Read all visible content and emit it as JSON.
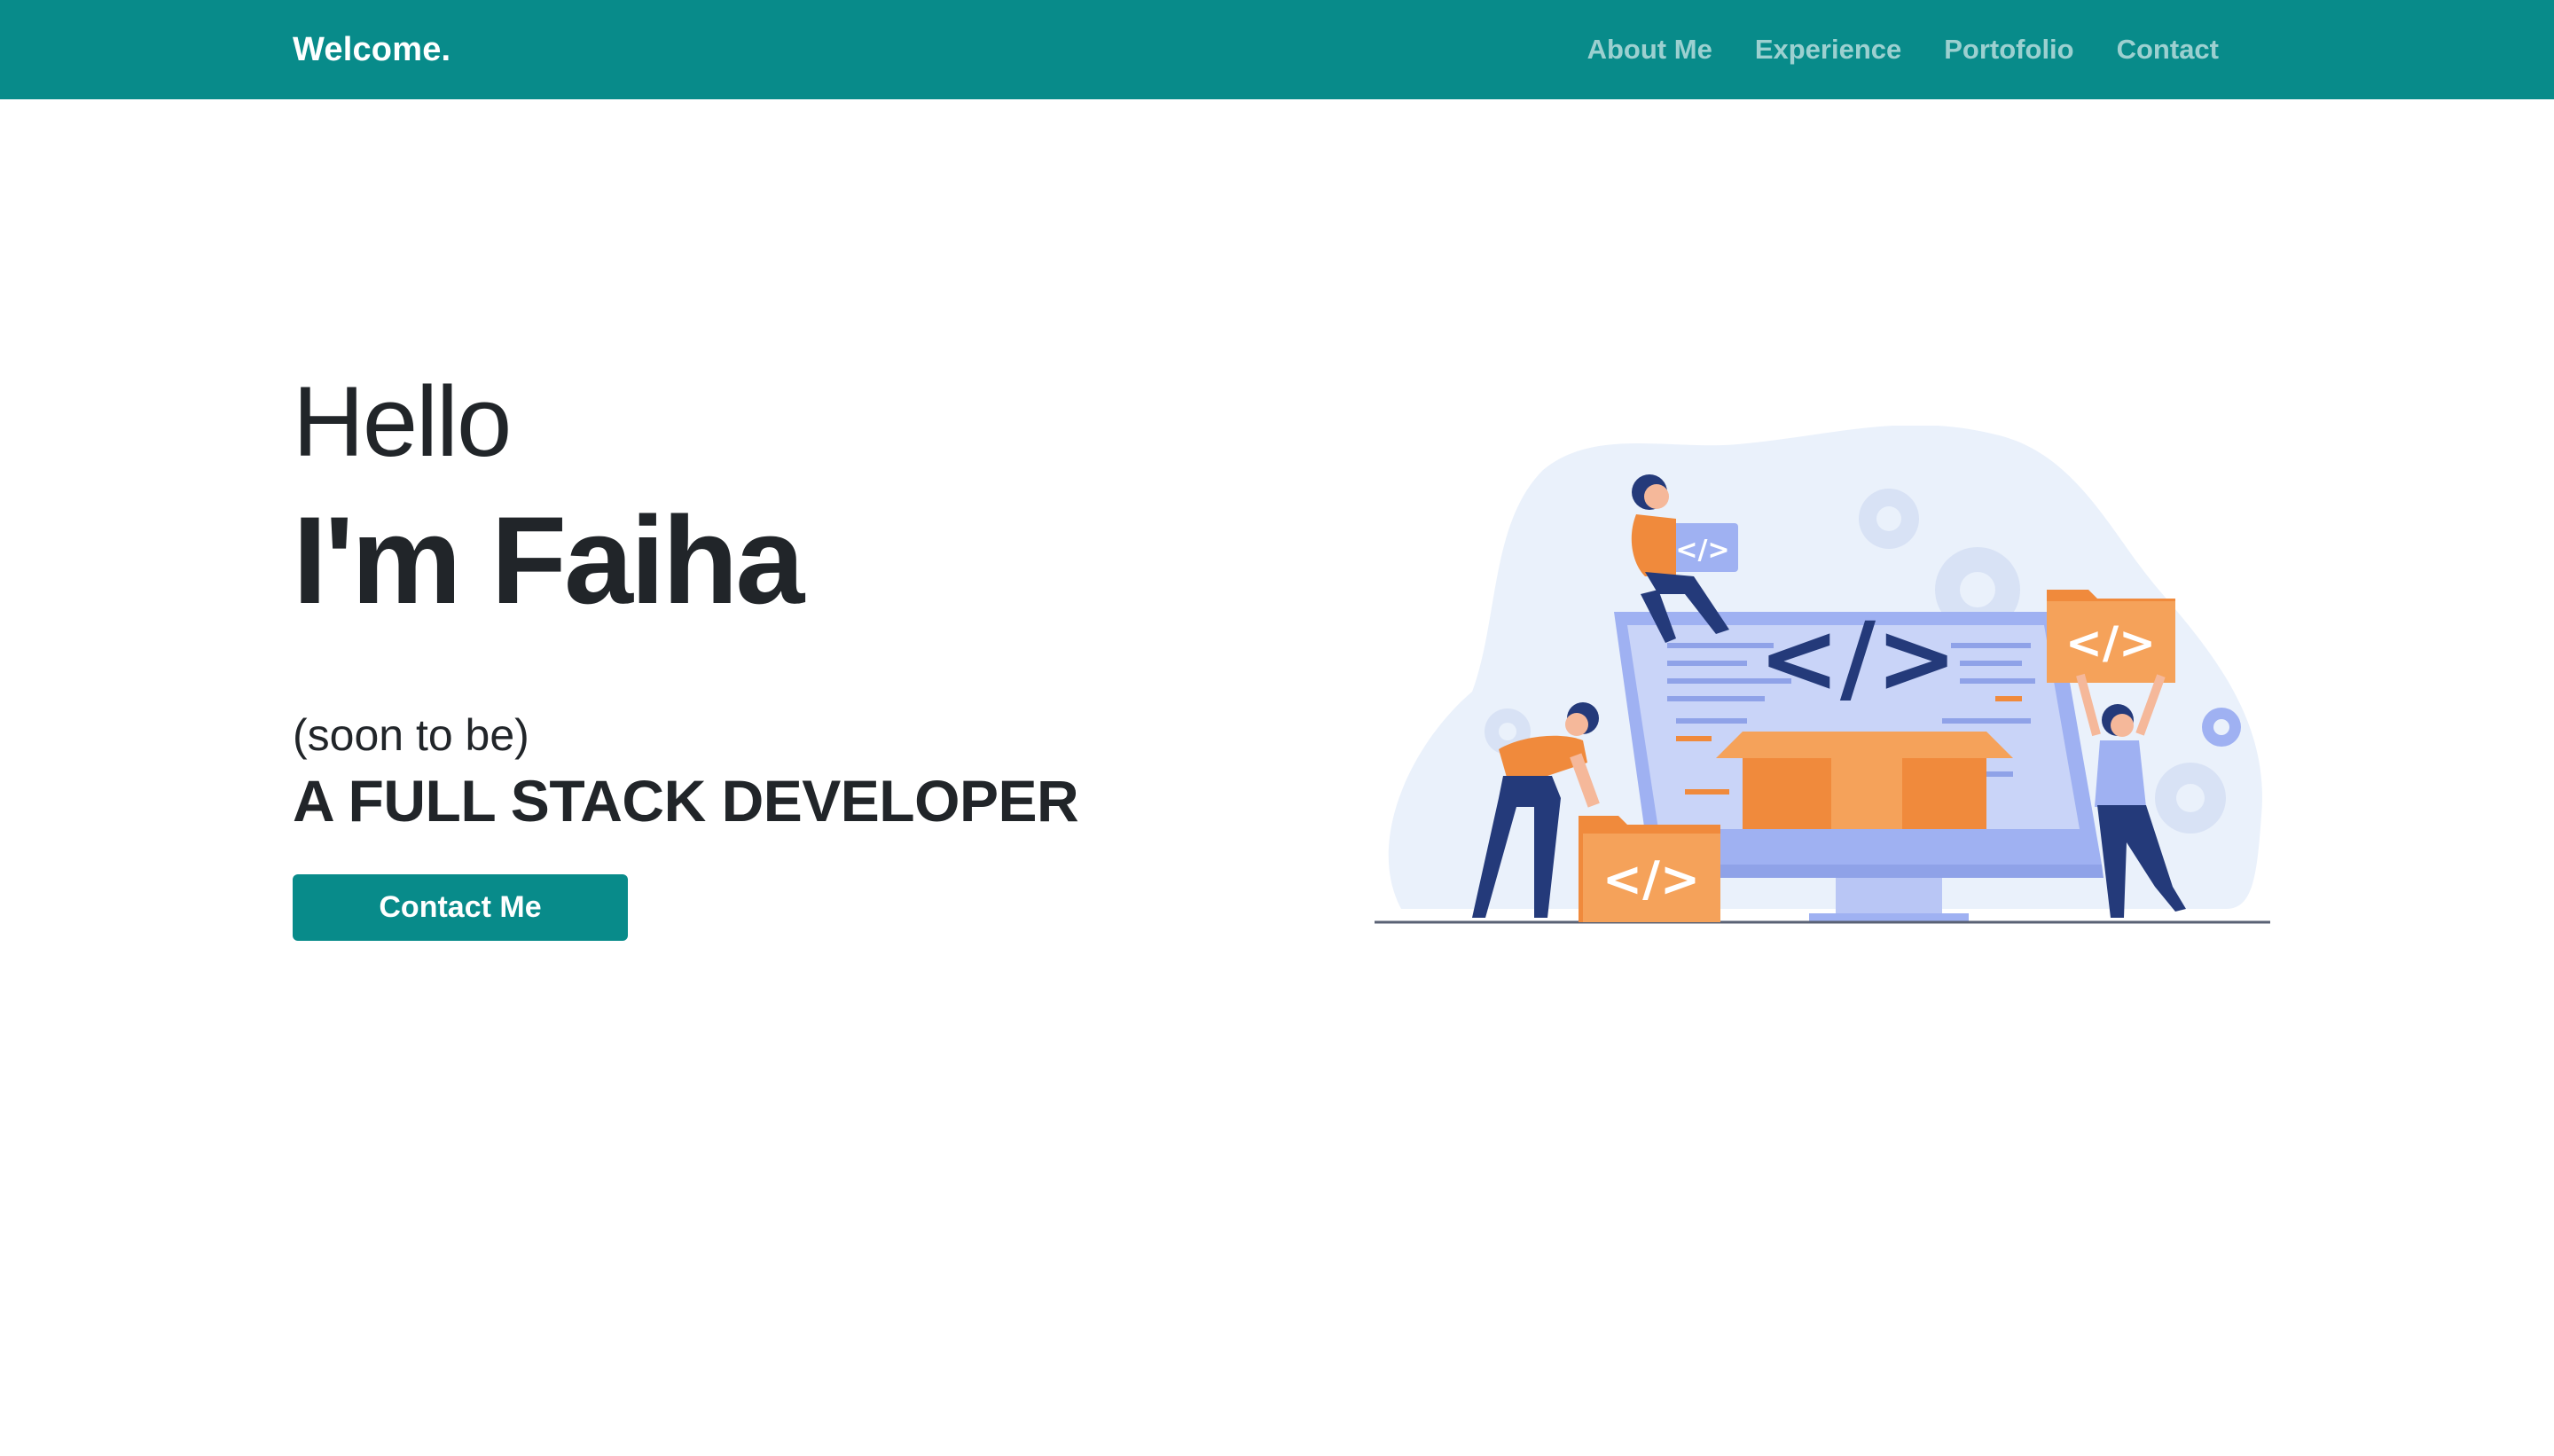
{
  "nav": {
    "brand": "Welcome.",
    "links": [
      "About Me",
      "Experience",
      "Portofolio",
      "Contact"
    ]
  },
  "hero": {
    "greeting": "Hello",
    "name": "I'm Faiha",
    "prefix": "(soon to be)",
    "role": "A FULL STACK DEVELOPER",
    "button_label": "Contact Me"
  },
  "illustration": {
    "tags": [
      "</>",
      "</>",
      "</>",
      "</>"
    ]
  },
  "colors": {
    "primary": "#088b8a",
    "accent_orange": "#f08a3c",
    "accent_blue": "#9fb1f2",
    "navy": "#243a7a"
  }
}
